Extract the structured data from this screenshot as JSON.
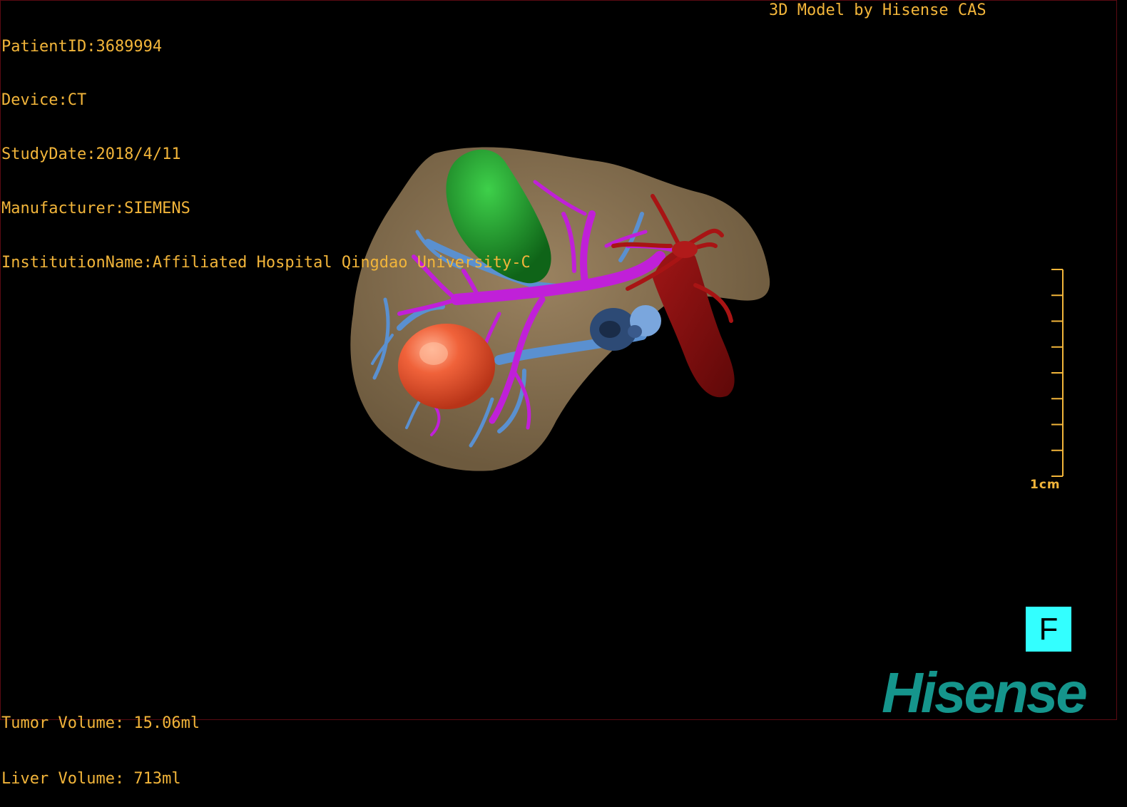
{
  "info": {
    "patient_id": "PatientID:3689994",
    "device": "Device:CT",
    "study_date": "StudyDate:2018/4/11",
    "manufacturer": "Manufacturer:SIEMENS",
    "institution": "InstitutionName:Affiliated Hospital Qingdao University-C"
  },
  "credit": "3D Model by Hisense CAS",
  "volumes": {
    "tumor": "Tumor Volume: 15.06ml",
    "liver": "Liver Volume: 713ml"
  },
  "scale_bar": {
    "label": "1cm",
    "ticks": 9
  },
  "view_button": {
    "label": "F"
  },
  "logo": {
    "text": "Hisense"
  },
  "colors": {
    "overlay_text": "#f2b53a",
    "liver": "#8a7352",
    "gallbladder": "#1f9a2a",
    "tumor": "#e8542e",
    "portal_vein": "#c020d8",
    "hepatic_vein": "#5a90d0",
    "ivc": "#8a0e0e",
    "view_button": "#33ffff",
    "logo": "#15958c"
  }
}
